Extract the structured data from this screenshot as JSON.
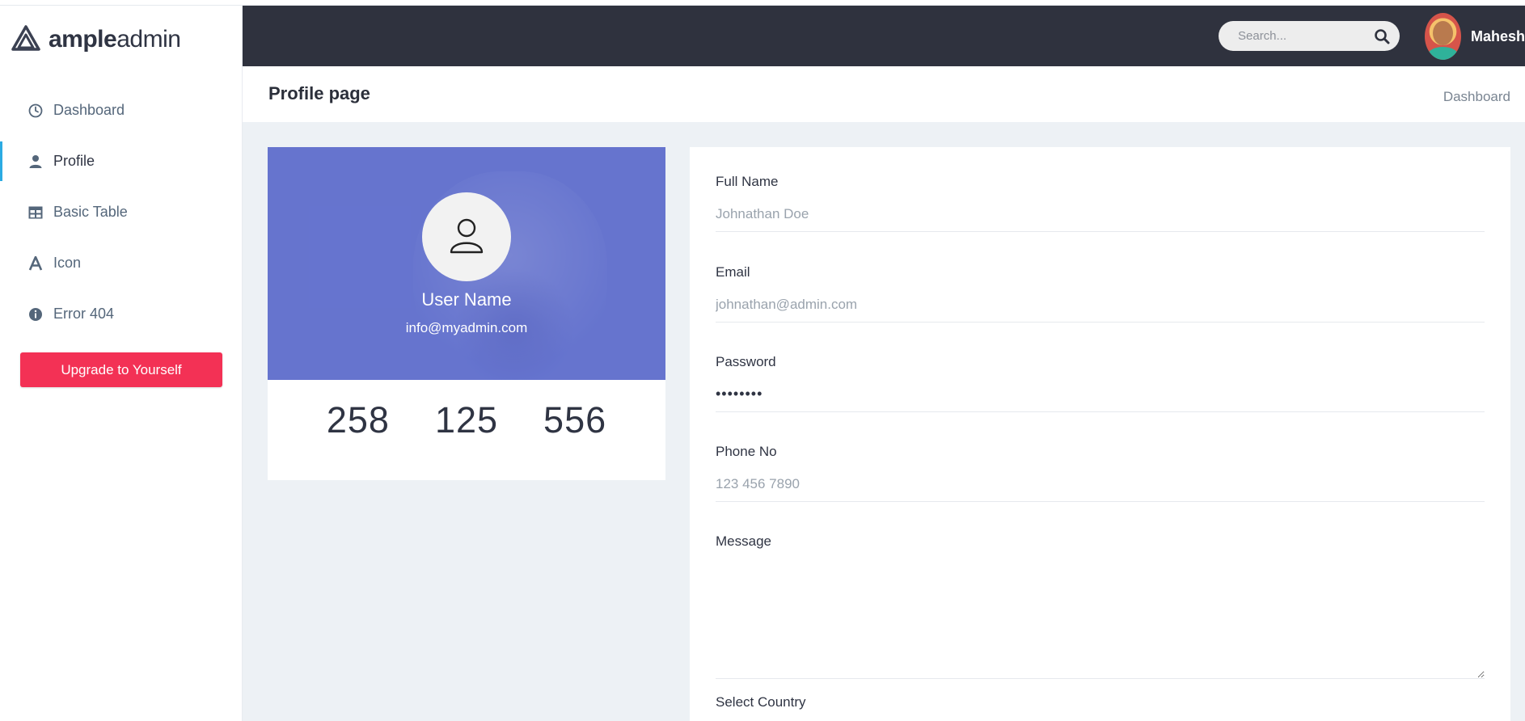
{
  "brand": {
    "logo_bold": "ample",
    "logo_thin": "admin"
  },
  "sidebar": {
    "items": [
      {
        "label": "Dashboard",
        "icon": "clock-icon",
        "active": false
      },
      {
        "label": "Profile",
        "icon": "user-icon",
        "active": true
      },
      {
        "label": "Basic Table",
        "icon": "table-icon",
        "active": false
      },
      {
        "label": "Icon",
        "icon": "font-icon",
        "active": false
      },
      {
        "label": "Error 404",
        "icon": "info-circle-icon",
        "active": false
      }
    ],
    "upgrade_label": "Upgrade to Yourself"
  },
  "topbar": {
    "search_placeholder": "Search...",
    "user_name": "Mahesh"
  },
  "page": {
    "title": "Profile page",
    "breadcrumb": "Dashboard"
  },
  "profile": {
    "name": "User Name",
    "email": "info@myadmin.com",
    "stats": [
      "258",
      "125",
      "556"
    ]
  },
  "form": {
    "full_name": {
      "label": "Full Name",
      "placeholder": "Johnathan Doe"
    },
    "email": {
      "label": "Email",
      "placeholder": "johnathan@admin.com"
    },
    "password": {
      "label": "Password",
      "value": "••••••••"
    },
    "phone": {
      "label": "Phone No",
      "placeholder": "123 456 7890"
    },
    "message": {
      "label": "Message",
      "placeholder": ""
    },
    "country": {
      "label": "Select Country"
    }
  },
  "colors": {
    "accent": "#2cabe3",
    "topbar": "#2f323e",
    "upgrade": "#f33155",
    "cover": "#6472cb"
  }
}
